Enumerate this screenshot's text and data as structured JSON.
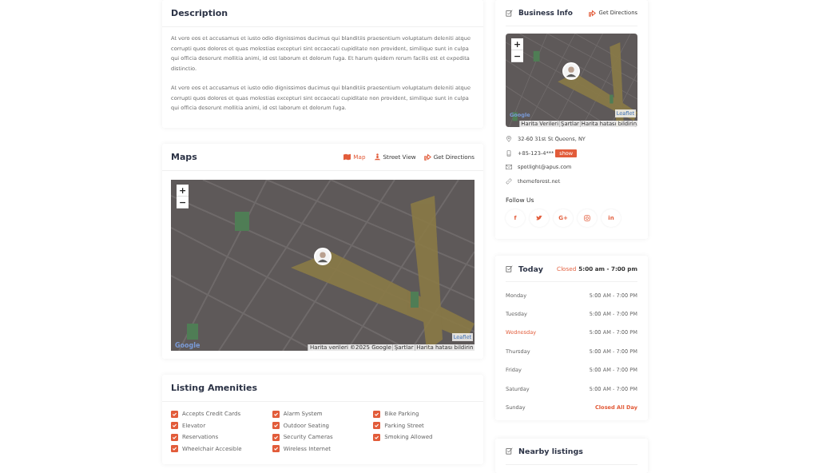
{
  "description": {
    "title": "Description",
    "paragraphs": [
      "At vero eos et accusamus et iusto odio dignissimos ducimus qui blanditiis praesentium voluptatum deleniti atque corrupti quos dolores et quas molestias excepturi sint occaecati cupiditate non provident, similique sunt in culpa qui officia deserunt mollitia animi, id est laborum et dolorum fuga. Et harum quidem rerum facilis est et expedita distinctio.",
      "At vero eos et accusamus et iusto odio dignissimos ducimus qui blanditiis praesentium voluptatum deleniti atque corrupti quos dolores et quas molestias excepturi sint occaecati cupiditate non provident, similique sunt in culpa qui officia deserunt mollitia animi, id est laborum et dolorum fuga."
    ]
  },
  "maps": {
    "title": "Maps",
    "tabs": [
      {
        "kind": "map",
        "label": "Map",
        "selected": true
      },
      {
        "kind": "street",
        "label": "Street View",
        "selected": false
      },
      {
        "kind": "directions",
        "label": "Get Directions",
        "selected": false
      }
    ],
    "zoom_in": "+",
    "zoom_out": "−",
    "logo": "Google",
    "leaflet": "Leaflet",
    "attribution": [
      "Harita verileri ©2025 Google",
      "Şartlar",
      "Harita hatası bildirin"
    ]
  },
  "amenities": {
    "title": "Listing Amenities",
    "items": [
      {
        "label": "Accepts Credit Cards",
        "checked": true
      },
      {
        "label": "Alarm System",
        "checked": true
      },
      {
        "label": "Bike Parking",
        "checked": true
      },
      {
        "label": "Elevator",
        "checked": true
      },
      {
        "label": "Outdoor Seating",
        "checked": true
      },
      {
        "label": "Parking Street",
        "checked": true
      },
      {
        "label": "Reservations",
        "checked": true
      },
      {
        "label": "Security Cameras",
        "checked": true
      },
      {
        "label": "Smoking Allowed",
        "checked": true
      },
      {
        "label": "Wheelchair Accesible",
        "checked": true
      },
      {
        "label": "Wireless Internet",
        "checked": true
      }
    ]
  },
  "business_info": {
    "title": "Business Info",
    "directions": "Get Directions",
    "map": {
      "zoom_in": "+",
      "zoom_out": "−",
      "logo": "Google",
      "leaflet": "Leaflet",
      "attribution": [
        "Harita Verileri",
        "Şartlar",
        "Harita hatası bildirin"
      ]
    },
    "contacts": [
      {
        "kind": "address",
        "text": "32-60 31st St Queens, NY"
      },
      {
        "kind": "phone",
        "text": "+85-123-4***",
        "button": "show"
      },
      {
        "kind": "email",
        "text": "spotlight@apus.com"
      },
      {
        "kind": "website",
        "text": "themeforest.net"
      }
    ],
    "follow_title": "Follow Us",
    "social": [
      {
        "kind": "facebook",
        "label": "f"
      },
      {
        "kind": "twitter"
      },
      {
        "kind": "google",
        "label": "G+"
      },
      {
        "kind": "instagram"
      },
      {
        "kind": "linkedin",
        "label": "in"
      }
    ]
  },
  "today": {
    "title": "Today",
    "status": "Closed",
    "hours": "5:00 am - 7:00 pm",
    "days": [
      {
        "day": "Monday",
        "hours": "5:00 AM - 7:00 PM",
        "today": false,
        "closed": false
      },
      {
        "day": "Tuesday",
        "hours": "5:00 AM - 7:00 PM",
        "today": false,
        "closed": false
      },
      {
        "day": "Wednesday",
        "hours": "5:00 AM - 7:00 PM",
        "today": true,
        "closed": false
      },
      {
        "day": "Thursday",
        "hours": "5:00 AM - 7:00 PM",
        "today": false,
        "closed": false
      },
      {
        "day": "Friday",
        "hours": "5:00 AM - 7:00 PM",
        "today": false,
        "closed": false
      },
      {
        "day": "Saturday",
        "hours": "5:00 AM - 7:00 PM",
        "today": false,
        "closed": false
      },
      {
        "day": "Sunday",
        "hours": "Closed All Day",
        "today": false,
        "closed": true
      }
    ]
  },
  "nearby": {
    "title": "Nearby listings"
  }
}
